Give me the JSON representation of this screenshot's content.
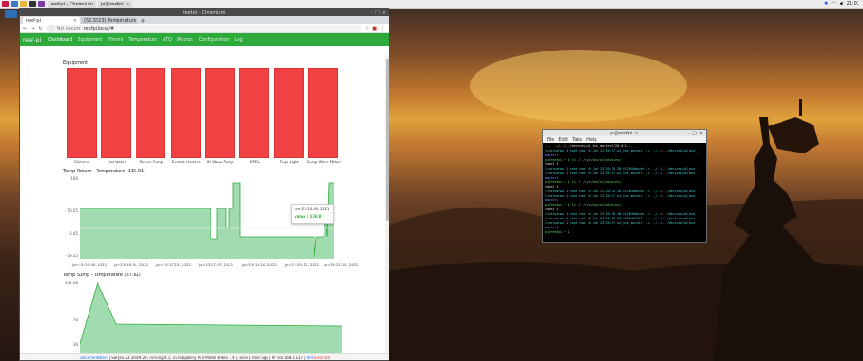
{
  "taskbar": {
    "tasks": [
      "reef-pi - Chromium",
      "pi@reefpi: ~"
    ],
    "clock": "21:01"
  },
  "browser": {
    "window_title": "reef-pi - Chromium",
    "tabs": [
      {
        "label": "reef-pi"
      },
      {
        "label": "(52.5923) Temperature"
      }
    ],
    "url_security": "Not secure",
    "url": "reefpi.local/#"
  },
  "nav": {
    "brand": "reef-pi",
    "items": [
      "Dashboard",
      "Equipment",
      "Timers",
      "Temperature",
      "ATO",
      "Macros",
      "Configuration",
      "Log"
    ]
  },
  "equipment_chart": {
    "title": "Equipment",
    "labels": [
      "Skimmer",
      "Hot Water",
      "Return Pump",
      "Electric Heaters",
      "80 Wave Pump",
      "OPEN",
      "Fuge Light",
      "Sump Wave Maker"
    ]
  },
  "chart_data": [
    {
      "type": "bar",
      "title": "Equipment",
      "categories": [
        "Skimmer",
        "Hot Water",
        "Return Pump",
        "Electric Heaters",
        "80 Wave Pump",
        "OPEN",
        "Fuge Light",
        "Sump Wave Maker"
      ],
      "values": [
        1,
        1,
        1,
        1,
        1,
        1,
        1,
        1
      ]
    },
    {
      "type": "area",
      "title": "Temp Return - Temperature (139.01)",
      "yticks": [
        "100",
        "50.55",
        "-6.45",
        "-59.45"
      ],
      "ylim": [
        -59.45,
        100
      ],
      "x": [
        "Jan-23-16:46, 2021",
        "Jan-23-16:34, 2021",
        "Jan-23-17:23, 2021",
        "Jan-23-17:07, 2021",
        "Jan-23-19:20, 2021",
        "Jan-23-20:11, 2021",
        "Jan-23-21:00, 2021"
      ],
      "values": [
        50,
        50,
        50,
        50,
        -20,
        -20,
        80
      ],
      "tooltip": {
        "date": "Jan-23-20:59, 2021",
        "value": "value : 139.8"
      }
    },
    {
      "type": "area",
      "title": "Temp Sump - Temperature (87.61)",
      "yticks": [
        "144.08",
        "76",
        "36"
      ],
      "values": [
        110,
        144,
        60,
        58,
        58,
        58,
        58
      ]
    }
  ],
  "temp_return": {
    "title": "Temp Return - Temperature (139.01)",
    "yticks": [
      "100",
      "50.55",
      "-6.45",
      "-59.45"
    ],
    "xticks": [
      "Jan-23-16:46, 2021",
      "Jan-23-16:34, 2021",
      "Jan-23-17:23, 2021",
      "Jan-23-17:07, 2021",
      "Jan-23-19:20, 2021",
      "Jan-23-20:11, 2021",
      "Jan-23-21:00, 2021"
    ],
    "tooltip_date": "Jan-23-20:59, 2021",
    "tooltip_value": "value : 139.8"
  },
  "temp_sump": {
    "title": "Temp Sump - Temperature (87.61)",
    "yticks": [
      "144.08",
      "76",
      "36"
    ]
  },
  "footer": {
    "docs": "Documentation",
    "info": "| Sat Jan 23 20:49:29, running 4.1, on Raspberry Pi 4 Model B Rev 1.4 | since 1 hour ago | IP 192.168.1.137 |",
    "api": "API",
    "errors": "Errors(0)"
  },
  "terminal": {
    "title": "pi@reefpi: ~",
    "menu": [
      "File",
      "Edit",
      "Tabs",
      "Help"
    ],
    "lines": [
      "...  ../../../devices/w1_bus_master1/28-012...",
      "lrwxrwxrwx 1 root root 0 Jan 23 20:17 w1_bus_master1 -> ../../../devices/w1_bus_",
      "master1",
      "pi@reefpi:~ $ ls -l /sys/bus/w1/devices/",
      "total 0",
      "lrwxrwxrwx 1 root root 0 Jan 23 20:34 28-012049abcd0 -> ../../../devices/w1_bus",
      "lrwxrwxrwx 1 root root 0 Jan 23 20:17 w1_bus_master1 -> ../../../devices/w1_bus",
      "master1",
      "pi@reefpi:~ $ ls -l /sys/bus/w1/devices/",
      "total 0",
      "lrwxrwxrwx 1 root root 0 Jan 23 20:34 28-012049abcd0 -> ../../../devices/w1_bus",
      "lrwxrwxrwx 1 root root 0 Jan 23 20:17 w1_bus_master1 -> ../../../devices/w1_bus",
      "master1",
      "pi@reefpi:~ $ ls -l /sys/bus/w1/devices/",
      "total 0",
      "lrwxrwxrwx 1 root root 0 Jan 23 20:34 28-012049abcd0 -> ../../../devices/w1_bus",
      "lrwxrwxrwx 1 root root 0 Jan 23 20:58 28-01204077277 -> ../../../devices/w1_bus",
      "lrwxrwxrwx 1 root root 0 Jan 23 20:17 w1_bus_master1 -> ../../../devices/w1_bus",
      "master1",
      "pi@reefpi:~ $ "
    ]
  }
}
